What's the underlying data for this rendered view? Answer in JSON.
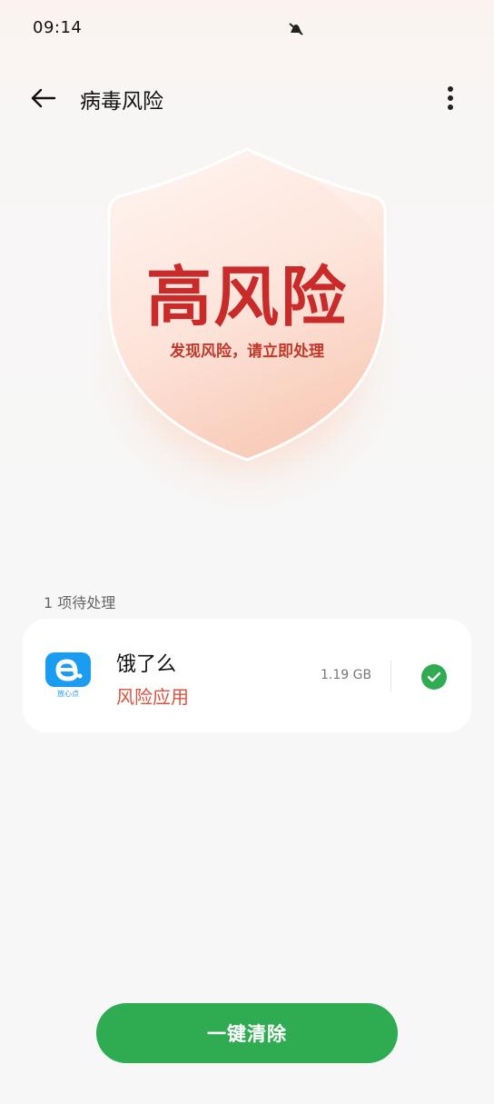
{
  "status_bar": {
    "time": "09:14"
  },
  "header": {
    "title": "病毒风险"
  },
  "shield": {
    "level": "高风险",
    "description": "发现风险，请立即处理"
  },
  "pending": {
    "label": "1 项待处理",
    "items": [
      {
        "name": "饿了么",
        "risk": "风险应用",
        "size": "1.19 GB",
        "icon_badge": "放心点",
        "checked": true
      }
    ]
  },
  "actions": {
    "clean_label": "一键清除"
  },
  "colors": {
    "accent_green": "#2fab52",
    "risk_red": "#c92a2a",
    "app_blue": "#1a9cf0"
  }
}
